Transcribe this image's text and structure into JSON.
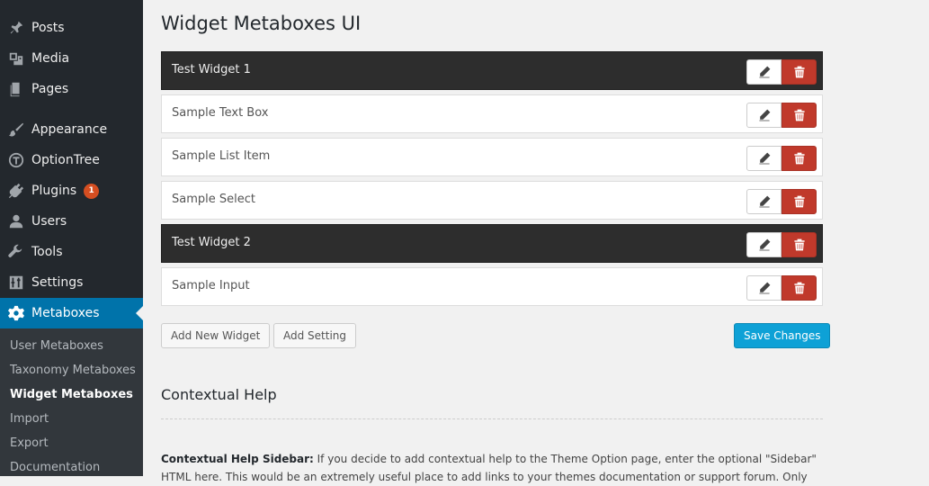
{
  "sidebar": {
    "items": [
      {
        "label": "Posts",
        "icon": "pin-icon"
      },
      {
        "label": "Media",
        "icon": "media-icon"
      },
      {
        "label": "Pages",
        "icon": "pages-icon"
      },
      {
        "label": "Appearance",
        "icon": "brush-icon"
      },
      {
        "label": "OptionTree",
        "icon": "optiontree-icon"
      },
      {
        "label": "Plugins",
        "icon": "plugin-icon",
        "badge": "1"
      },
      {
        "label": "Users",
        "icon": "user-icon"
      },
      {
        "label": "Tools",
        "icon": "wrench-icon"
      },
      {
        "label": "Settings",
        "icon": "sliders-icon"
      },
      {
        "label": "Metaboxes",
        "icon": "gear-icon",
        "current": true
      }
    ],
    "submenu": [
      {
        "label": "User Metaboxes"
      },
      {
        "label": "Taxonomy Metaboxes"
      },
      {
        "label": "Widget Metaboxes",
        "active": true
      },
      {
        "label": "Import"
      },
      {
        "label": "Export"
      },
      {
        "label": "Documentation"
      }
    ]
  },
  "page": {
    "title": "Widget Metaboxes UI"
  },
  "widgets": [
    {
      "label": "Test Widget 1",
      "dark": true
    },
    {
      "label": "Sample Text Box",
      "dark": false
    },
    {
      "label": "Sample List Item",
      "dark": false
    },
    {
      "label": "Sample Select",
      "dark": false
    },
    {
      "label": "Test Widget 2",
      "dark": true
    },
    {
      "label": "Sample Input",
      "dark": false
    }
  ],
  "buttons": {
    "add_widget": "Add New Widget",
    "add_setting": "Add Setting",
    "save": "Save Changes"
  },
  "help": {
    "title": "Contextual Help",
    "text_label": "Contextual Help Sidebar:",
    "text_body": " If you decide to add contextual help to the Theme Option page, enter the optional \"Sidebar\" HTML here. This would be an extremely useful place to add links to your themes documentation or support forum. Only"
  },
  "colors": {
    "sidebar_bg": "#23282d",
    "submenu_bg": "#32373c",
    "accent": "#0073aa",
    "delete_red": "#c0392b",
    "save_blue": "#0ea1d6",
    "badge": "#d54e21"
  }
}
